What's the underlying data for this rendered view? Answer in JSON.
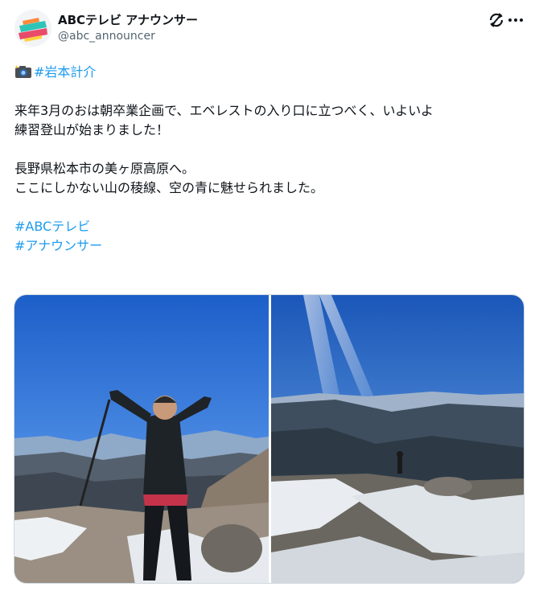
{
  "author": {
    "display_name": "ABCテレビ アナウンサー",
    "handle": "@abc_announcer",
    "avatar_icon": "abc-announcer-logo-icon"
  },
  "icons": {
    "sync": "sync-icon",
    "more": "more-options-icon",
    "camera": "camera-flash-emoji-icon"
  },
  "post": {
    "hashtag_person": "#岩本計介",
    "line1": "来年3月のおは朝卒業企画で、エベレストの入り口に立つべく、いよいよ",
    "line2": "練習登山が始まりました！",
    "line3": "長野県松本市の美ヶ原高原へ。",
    "line4": "ここにしかない山の稜線、空の青に魅せられました。",
    "hashtag1": "#ABCテレビ",
    "hashtag2": "#アナウンサー"
  },
  "media": [
    {
      "icon": "mountain-summit-person-photo"
    },
    {
      "icon": "mountain-ridge-view-photo"
    }
  ],
  "colors": {
    "link": "#1d9bf0",
    "text": "#0f1419",
    "secondary": "#536471"
  }
}
